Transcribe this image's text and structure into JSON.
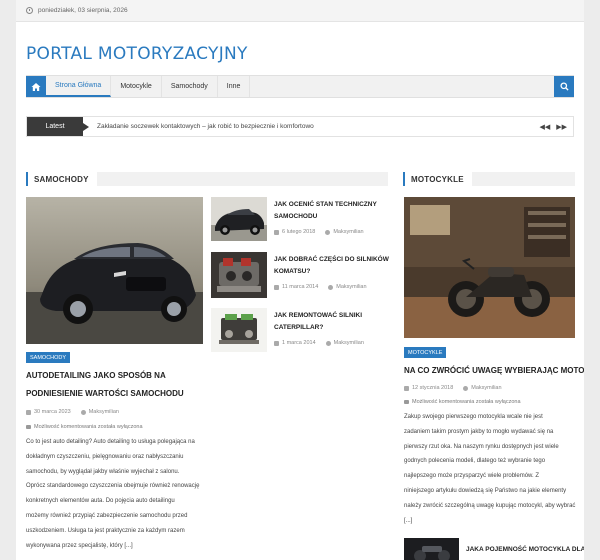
{
  "topbar": {
    "date": "poniedziałek, 03 sierpnia, 2026"
  },
  "site": {
    "title": "PORTAL MOTORYZACYJNY"
  },
  "nav": {
    "items": [
      {
        "label": "Strona Główna"
      },
      {
        "label": "Motocykle"
      },
      {
        "label": "Samochody"
      },
      {
        "label": "Inne"
      }
    ]
  },
  "ticker": {
    "label": "Latest",
    "text": "Zakładanie soczewek kontaktowych – jak robić to bezpiecznie i komfortowo"
  },
  "samochody": {
    "heading": "SAMOCHODY",
    "main": {
      "badge": "SAMOCHODY",
      "title_line1": "AUTODETAILING JAKO SPOSÓB NA",
      "title_line2": "PODNIESIENIE WARTOŚCI SAMOCHODU",
      "date": "30 marca 2023",
      "author": "Maksymilian",
      "comments": "Możliwość komentowania została wyłączona",
      "excerpt": [
        "Co to jest auto detailing? Auto detailing to usługa polegająca na",
        "dokładnym czyszczeniu, pielęgnowaniu oraz nabłyszczaniu",
        "samochodu, by wyglądał jakby właśnie wyjechał z salonu.",
        "Oprócz standardowego czyszczenia obejmuje również renowację",
        "konkretnych elementów auta. Do pojęcia auto detailingu",
        "możemy również przypiąć zabezpieczenie samochodu przed",
        "uszkodzeniem. Usługa ta jest praktycznie za każdym razem",
        "wykonywana przez specjalistę, który [...]"
      ]
    },
    "side": [
      {
        "title_line1": "JAK OCENIĆ STAN TECHNICZNY",
        "title_line2": "SAMOCHODU",
        "date": "6 lutego 2018",
        "author": "Maksymilian"
      },
      {
        "title_line1": "JAK DOBRAĆ CZĘŚCI DO SILNIKÓW",
        "title_line2": "KOMATSU?",
        "date": "11 marca 2014",
        "author": "Maksymilian"
      },
      {
        "title_line1": "JAK REMONTOWAĆ SILNIKI",
        "title_line2": "CATERPILLAR?",
        "date": "1 marca 2014",
        "author": "Maksymilian"
      }
    ]
  },
  "motocykle": {
    "heading": "MOTOCYKLE",
    "main": {
      "badge": "MOTOCYKLE",
      "title": "NA CO ZWRÓCIĆ UWAGĘ WYBIERAJĄC MOTOR",
      "date": "12 stycznia 2018",
      "author": "Maksymilian",
      "comments": "Możliwość komentowania została wyłączona",
      "excerpt": [
        "Zakup swojego pierwszego motocykla wcale nie jest",
        "zadaniem takim prostym jakby to mogło wydawać się na",
        "pierwszy rzut oka. Na naszym rynku dostępnych jest wiele",
        "godnych polecenia modeli, dlatego też wybranie tego",
        "najlepszego może przysparzyć wiele problemów. Z",
        "niniejszego artykułu dowiedzą się Państwo na jakie elementy",
        "należy zwrócić szczególną uwagę kupując motocykl, aby wybrać [...]"
      ]
    },
    "next": {
      "title": "JAKA POJEMNOŚĆ MOTOCYKLA DLA"
    }
  },
  "colors": {
    "accent": "#2a7abf",
    "ticker_label_bg": "#3a3a3a"
  }
}
